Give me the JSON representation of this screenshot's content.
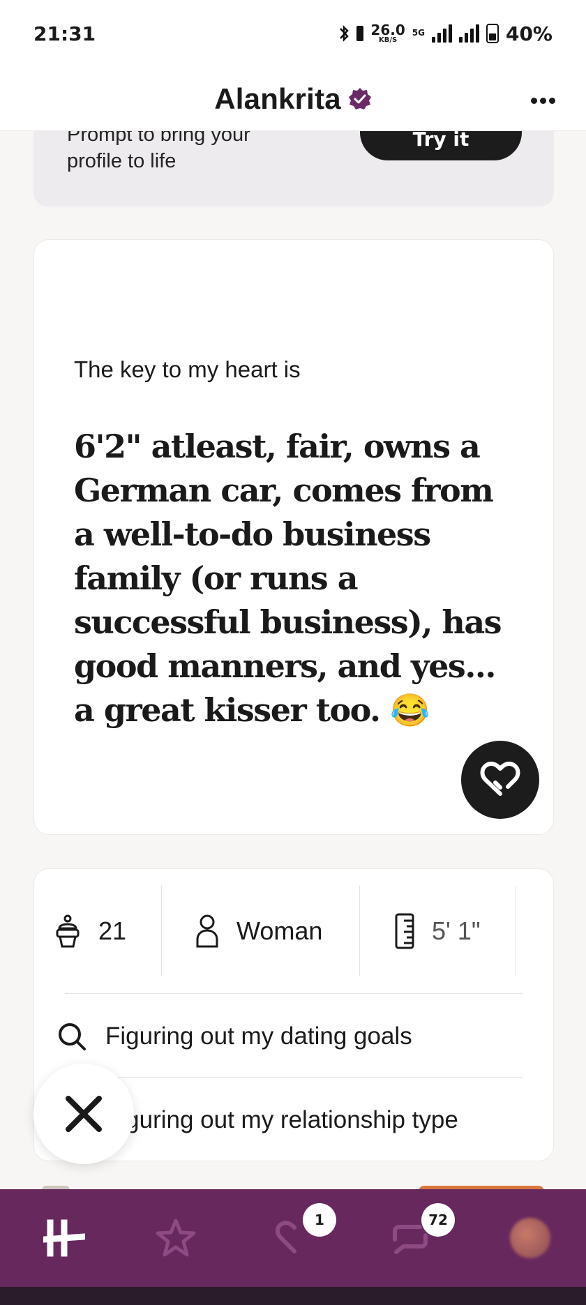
{
  "status_bar": {
    "time": "21:31",
    "net_speed": "26.0",
    "net_unit": "KB/S",
    "network_type": "5G",
    "battery": "40%"
  },
  "header": {
    "name": "Alankrita"
  },
  "tip_card": {
    "text_line1": "Prompt to bring your",
    "text_line2": "profile to life",
    "button_label": "Try it"
  },
  "prompt": {
    "question": "The key to my heart is",
    "answer": "6'2\" atleast, fair, owns a German car, comes from a well-to-do business family (or runs a successful business), has good manners, and yes... a great kisser too. 😂"
  },
  "vitals": {
    "age": "21",
    "gender": "Woman",
    "height": "5' 1\""
  },
  "details": {
    "dating_goals": "Figuring out my dating goals",
    "relationship_type": "Figuring out my relationship type"
  },
  "nav": {
    "likes_badge": "1",
    "chats_badge": "72"
  },
  "colors": {
    "brand_purple": "#67285e",
    "dark_button": "#1c1c1c",
    "verified_badge": "#6b2a67"
  }
}
